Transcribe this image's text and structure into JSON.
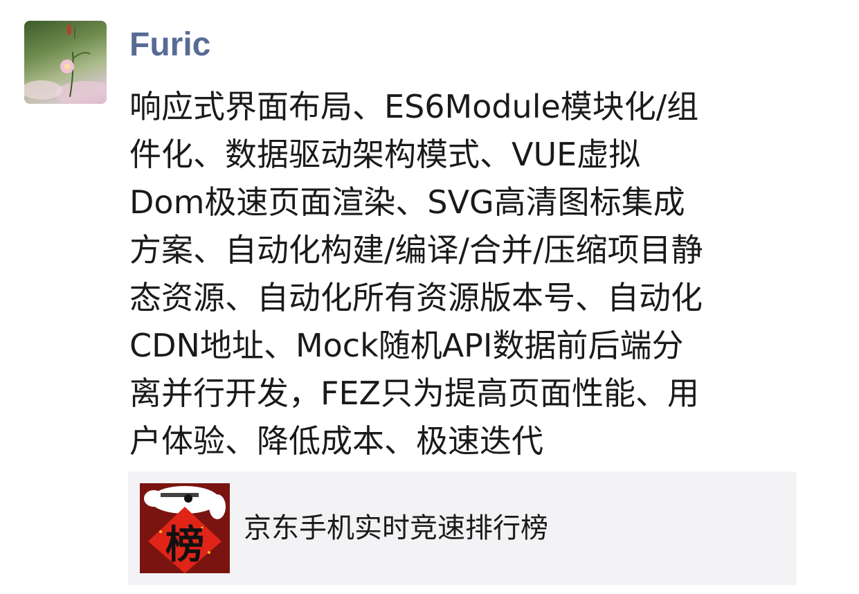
{
  "post": {
    "author": "Furic",
    "avatar_icon": "flower-photo-avatar",
    "text_lines": [
      "响应式界面布局、ES6Module模块化/组",
      "件化、数据驱动架构模式、VUE虚拟",
      "Dom极速页面渲染、SVG高清图标集成",
      "方案、自动化构建/编译/合并/压缩项目静",
      "态资源、自动化所有资源版本号、自动化",
      "CDN地址、Mock随机API数据前后端分",
      "离并行开发，FEZ只为提高页面性能、用",
      "户体验、降低成本、极速迭代"
    ],
    "author_color": "#576b95"
  },
  "link_card": {
    "title": "京东手机实时竞速排行榜",
    "thumb_char": "榜",
    "thumb_icon": "jd-dog-ranking-icon",
    "background": "#f3f3f5"
  }
}
